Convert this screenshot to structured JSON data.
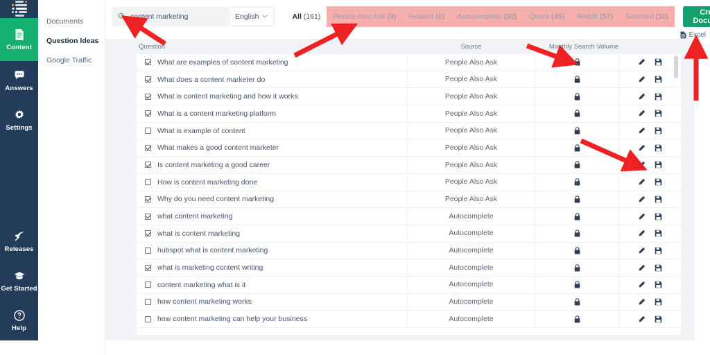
{
  "rail": {
    "logo_icon": "dashboard-logo-icon",
    "items": [
      {
        "label": "Content",
        "icon": "document-icon",
        "active": true
      },
      {
        "label": "Answers",
        "icon": "chat-bubble-icon",
        "active": false
      },
      {
        "label": "Settings",
        "icon": "gear-icon",
        "active": false
      },
      {
        "label": "Releases",
        "icon": "rocket-icon",
        "active": false
      },
      {
        "label": "Get Started",
        "icon": "graduation-cap-icon",
        "active": false
      },
      {
        "label": "Help",
        "icon": "question-circle-icon",
        "active": false
      }
    ]
  },
  "subnav": {
    "items": [
      {
        "label": "Documents",
        "current": false
      },
      {
        "label": "Question Ideas",
        "current": true
      },
      {
        "label": "Google Traffic",
        "current": false
      }
    ]
  },
  "search": {
    "value": "content marketing",
    "placeholder": "Search",
    "icon": "search-icon"
  },
  "language": {
    "selected": "English",
    "icon": "chevron-down-icon",
    "options": [
      "English"
    ]
  },
  "tabs": [
    {
      "label": "All",
      "count": "(161)",
      "selected": true,
      "highlighted": false
    },
    {
      "label": "People Also Ask",
      "count": "(9)",
      "selected": false,
      "highlighted": true
    },
    {
      "label": "Related",
      "count": "(0)",
      "selected": false,
      "highlighted": true
    },
    {
      "label": "Autocomplete",
      "count": "(50)",
      "selected": false,
      "highlighted": true
    },
    {
      "label": "Quora",
      "count": "(45)",
      "selected": false,
      "highlighted": true
    },
    {
      "label": "Reddit",
      "count": "(57)",
      "selected": false,
      "highlighted": true
    },
    {
      "label": "Selected",
      "count": "(10)",
      "selected": false,
      "highlighted": true
    }
  ],
  "actions": {
    "create_document": "Create Document",
    "excel_export": "Excel",
    "excel_icon": "excel-file-icon"
  },
  "table": {
    "columns": {
      "question": "Question",
      "source": "Source",
      "volume": "Monthly Search Volume",
      "actions": ""
    },
    "row_icons": {
      "volume": "lock-icon",
      "edit": "pencil-icon",
      "save": "floppy-disk-icon"
    },
    "rows": [
      {
        "checked": true,
        "question": "What are examples of content marketing",
        "source": "People Also Ask"
      },
      {
        "checked": true,
        "question": "What does a content marketer do",
        "source": "People Also Ask"
      },
      {
        "checked": true,
        "question": "What is content marketing and how it works",
        "source": "People Also Ask"
      },
      {
        "checked": true,
        "question": "What is a content marketing platform",
        "source": "People Also Ask"
      },
      {
        "checked": false,
        "question": "What is example of content",
        "source": "People Also Ask"
      },
      {
        "checked": true,
        "question": "What makes a good content marketer",
        "source": "People Also Ask"
      },
      {
        "checked": true,
        "question": "Is content marketing a good career",
        "source": "People Also Ask"
      },
      {
        "checked": false,
        "question": "How is content marketing done",
        "source": "People Also Ask"
      },
      {
        "checked": true,
        "question": "Why do you need content marketing",
        "source": "People Also Ask"
      },
      {
        "checked": true,
        "question": "what content marketing",
        "source": "Autocomplete"
      },
      {
        "checked": true,
        "question": "what is content marketing",
        "source": "Autocomplete"
      },
      {
        "checked": false,
        "question": "hubspot what is content marketing",
        "source": "Autocomplete"
      },
      {
        "checked": true,
        "question": "what is marketing content writing",
        "source": "Autocomplete"
      },
      {
        "checked": false,
        "question": "content marketing what is it",
        "source": "Autocomplete"
      },
      {
        "checked": false,
        "question": "how content marketing works",
        "source": "Autocomplete"
      },
      {
        "checked": false,
        "question": "how content marketing can help your business",
        "source": "Autocomplete"
      }
    ]
  },
  "colors": {
    "rail_bg": "#223c5a",
    "accent_green": "#13b070",
    "button_green": "#13a06c",
    "tab_highlight": "#f7afab",
    "annotation_red": "#ee2222",
    "panel_bg": "#f1f3f6"
  },
  "annotations": [
    {
      "name": "arrow-to-search-field"
    },
    {
      "name": "arrow-to-people-also-ask-tab"
    },
    {
      "name": "arrow-to-monthly-search-volume-lock"
    },
    {
      "name": "arrow-to-row-edit-icon"
    },
    {
      "name": "arrow-to-excel-export"
    }
  ]
}
